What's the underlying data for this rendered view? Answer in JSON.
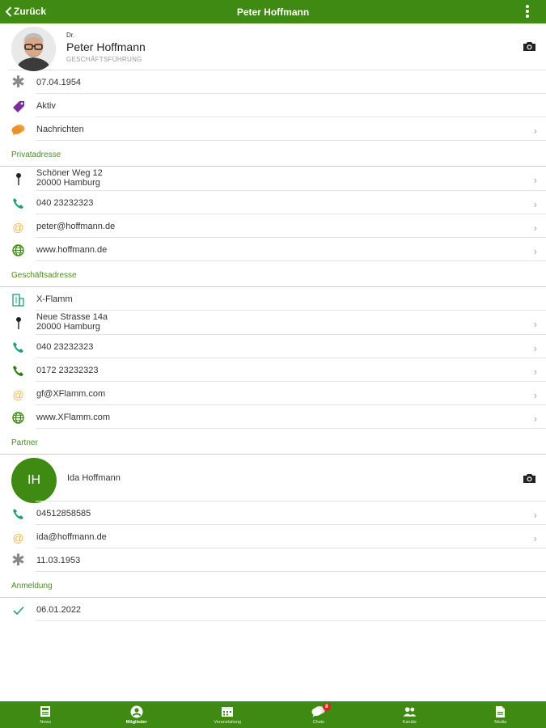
{
  "header": {
    "back_label": "Zurück",
    "title": "Peter Hoffmann"
  },
  "profile": {
    "title_prefix": "Dr.",
    "name": "Peter Hoffmann",
    "role": "GESCHÄFTSFÜHRUNG"
  },
  "personal": {
    "birthdate": "07.04.1954",
    "status": "Aktiv",
    "messages": "Nachrichten"
  },
  "private_address": {
    "heading": "Privatadresse",
    "street": "Schöner Weg 12",
    "city": "20000 Hamburg",
    "phone": "040 23232323",
    "email": "peter@hoffmann.de",
    "web": "www.hoffmann.de"
  },
  "business_address": {
    "heading": "Geschäftsadresse",
    "company": "X-Flamm",
    "street": "Neue Strasse 14a",
    "city": "20000 Hamburg",
    "phone": "040 23232323",
    "mobile": "0172 23232323",
    "email": "gf@XFlamm.com",
    "web": "www.XFlamm.com"
  },
  "partner": {
    "heading": "Partner",
    "initials": "IH",
    "name": "Ida Hoffmann",
    "phone": "04512858585",
    "email": "ida@hoffmann.de",
    "birthdate": "11.03.1953"
  },
  "registration": {
    "heading": "Anmeldung",
    "date": "06.01.2022"
  },
  "tabs": [
    {
      "label": "News",
      "icon": "news-icon"
    },
    {
      "label": "Mitglieder",
      "icon": "person-circle-icon",
      "active": true
    },
    {
      "label": "Veranstaltung",
      "icon": "calendar-icon"
    },
    {
      "label": "Chats",
      "icon": "chat-bubbles-icon",
      "badge": "8"
    },
    {
      "label": "Kanäle",
      "icon": "group-icon"
    },
    {
      "label": "Media",
      "icon": "document-icon"
    }
  ],
  "colors": {
    "brand_green": "#3f8a12",
    "icon_teal": "#1f9e79",
    "icon_purple": "#7b2d9b",
    "icon_orange": "#e8902a",
    "icon_gold": "#f2b84b",
    "badge_red": "#d9271d"
  }
}
